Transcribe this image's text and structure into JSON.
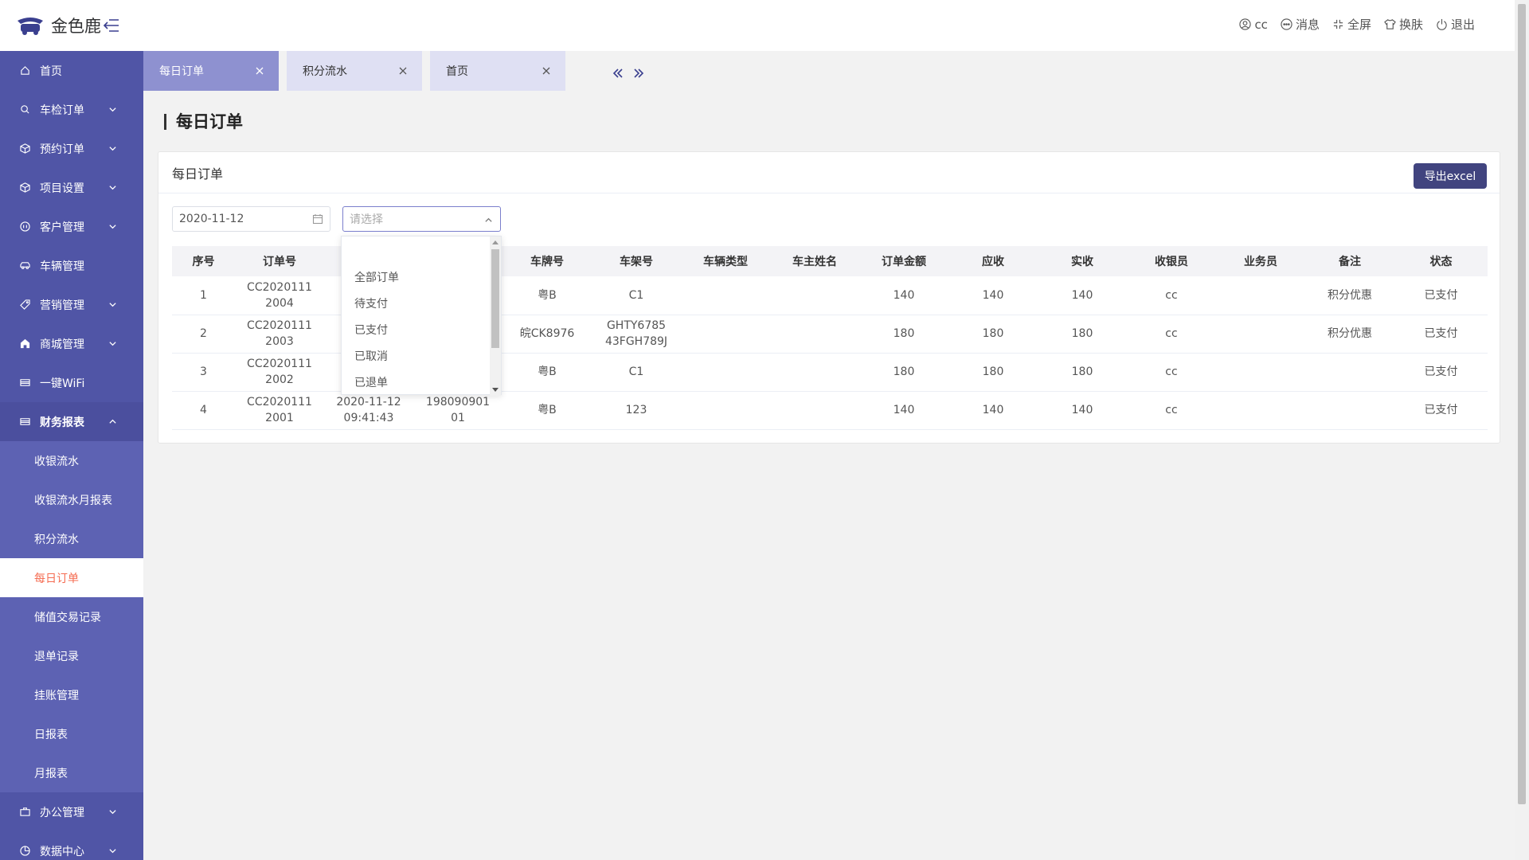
{
  "app": {
    "logo_text": "金色鹿"
  },
  "header": {
    "user": "cc",
    "messages": "消息",
    "fullscreen": "全屏",
    "skin": "换肤",
    "logout": "退出"
  },
  "sidebar": {
    "items": [
      {
        "label": "首页",
        "icon": "home-icon",
        "expandable": false
      },
      {
        "label": "车检订单",
        "icon": "search-icon",
        "expandable": true
      },
      {
        "label": "预约订单",
        "icon": "cube-icon",
        "expandable": true
      },
      {
        "label": "项目设置",
        "icon": "cube-icon",
        "expandable": true
      },
      {
        "label": "客户管理",
        "icon": "customer-icon",
        "expandable": true
      },
      {
        "label": "车辆管理",
        "icon": "car-icon",
        "expandable": false
      },
      {
        "label": "营销管理",
        "icon": "tag-icon",
        "expandable": true
      },
      {
        "label": "商城管理",
        "icon": "shop-icon",
        "expandable": true
      },
      {
        "label": "一键WiFi",
        "icon": "wifi-icon",
        "expandable": false
      },
      {
        "label": "财务报表",
        "icon": "report-icon",
        "expandable": true,
        "open": true
      }
    ],
    "finance_sub": [
      {
        "label": "收银流水"
      },
      {
        "label": "收银流水月报表"
      },
      {
        "label": "积分流水"
      },
      {
        "label": "每日订单",
        "active": true
      },
      {
        "label": "储值交易记录"
      },
      {
        "label": "退单记录"
      },
      {
        "label": "挂账管理"
      },
      {
        "label": "日报表"
      },
      {
        "label": "月报表"
      }
    ],
    "after_items": [
      {
        "label": "办公管理",
        "icon": "office-icon",
        "expandable": true
      },
      {
        "label": "数据中心",
        "icon": "data-icon",
        "expandable": true
      }
    ]
  },
  "tabs": [
    {
      "label": "每日订单",
      "active": true
    },
    {
      "label": "积分流水",
      "active": false
    },
    {
      "label": "首页",
      "active": false
    }
  ],
  "page": {
    "title": "每日订单"
  },
  "card": {
    "title": "每日订单",
    "export_label": "导出excel",
    "date_value": "2020-11-12",
    "select_placeholder": "请选择"
  },
  "dropdown": {
    "options": [
      "全部订单",
      "待支付",
      "已支付",
      "已取消",
      "已退单"
    ]
  },
  "table": {
    "columns": [
      "序号",
      "订单号",
      "",
      "",
      "车牌号",
      "车架号",
      "车辆类型",
      "车主姓名",
      "订单金额",
      "应收",
      "实收",
      "收银员",
      "业务员",
      "备注",
      "状态"
    ],
    "rows": [
      [
        "1",
        "CC2020111\n2004",
        "",
        "",
        "粤B",
        "C1",
        "",
        "",
        "140",
        "140",
        "140",
        "cc",
        "",
        "积分优惠",
        "已支付"
      ],
      [
        "2",
        "CC2020111\n2003",
        "",
        "",
        "皖CK8976",
        "GHTY6785\n43FGH789J",
        "",
        "",
        "180",
        "180",
        "180",
        "cc",
        "",
        "积分优惠",
        "已支付"
      ],
      [
        "3",
        "CC2020111\n2002",
        "",
        "",
        "粤B",
        "C1",
        "",
        "",
        "180",
        "180",
        "180",
        "cc",
        "",
        "",
        "已支付"
      ],
      [
        "4",
        "CC2020111\n2001",
        "2020-11-12\n09:41:43",
        "198090901\n01",
        "粤B",
        "123",
        "",
        "",
        "140",
        "140",
        "140",
        "cc",
        "",
        "",
        "已支付"
      ]
    ]
  },
  "colors": {
    "sidebar_bg": "#5055a6",
    "sidebar_sub_bg": "#5d62b3",
    "active_tab": "#8e91d0",
    "inactive_tab": "#dfe0f3",
    "export_btn": "#41447f",
    "active_sub_text": "#f56c52"
  }
}
